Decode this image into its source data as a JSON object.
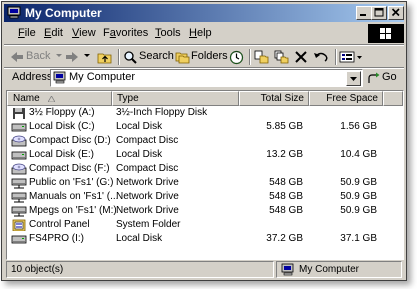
{
  "window": {
    "title": "My Computer"
  },
  "title_buttons": [
    "minimize",
    "maximize",
    "close"
  ],
  "menu": [
    {
      "label": "File",
      "u": "F",
      "rest": "ile"
    },
    {
      "label": "Edit",
      "u": "E",
      "rest": "dit"
    },
    {
      "label": "View",
      "u": "V",
      "rest": "iew"
    },
    {
      "label": "Favorites",
      "u": "a",
      "pre": "F",
      "rest": "vorites"
    },
    {
      "label": "Tools",
      "u": "T",
      "rest": "ools"
    },
    {
      "label": "Help",
      "u": "H",
      "rest": "elp"
    }
  ],
  "toolbar": {
    "back_label": "Back",
    "search_label": "Search",
    "folders_label": "Folders"
  },
  "address": {
    "label": "Address",
    "value": "My Computer",
    "go_label": "Go"
  },
  "columns": {
    "name": "Name",
    "type": "Type",
    "total_size": "Total Size",
    "free_space": "Free Space"
  },
  "rows": [
    {
      "name": "3½ Floppy (A:)",
      "type": "3½-Inch Floppy Disk",
      "total": "",
      "free": "",
      "icon": "floppy-icon"
    },
    {
      "name": "Local Disk (C:)",
      "type": "Local Disk",
      "total": "5.85 GB",
      "free": "1.56 GB",
      "icon": "hard-disk-icon"
    },
    {
      "name": "Compact Disc (D:)",
      "type": "Compact Disc",
      "total": "",
      "free": "",
      "icon": "cd-drive-icon"
    },
    {
      "name": "Local Disk (E:)",
      "type": "Local Disk",
      "total": "13.2 GB",
      "free": "10.4 GB",
      "icon": "hard-disk-icon"
    },
    {
      "name": "Compact Disc (F:)",
      "type": "Compact Disc",
      "total": "",
      "free": "",
      "icon": "cd-drive-icon"
    },
    {
      "name": "Public on 'Fs1' (G:)",
      "type": "Network Drive",
      "total": "548 GB",
      "free": "50.9 GB",
      "icon": "network-drive-icon"
    },
    {
      "name": "Manuals on 'Fs1' (...",
      "type": "Network Drive",
      "total": "548 GB",
      "free": "50.9 GB",
      "icon": "network-drive-icon"
    },
    {
      "name": "Mpegs on 'Fs1' (M:)",
      "type": "Network Drive",
      "total": "548 GB",
      "free": "50.9 GB",
      "icon": "network-drive-icon"
    },
    {
      "name": "Control Panel",
      "type": "System Folder",
      "total": "",
      "free": "",
      "icon": "control-panel-icon"
    },
    {
      "name": "FS4PRO (I:)",
      "type": "Local Disk",
      "total": "37.2 GB",
      "free": "37.1 GB",
      "icon": "hard-disk-icon"
    }
  ],
  "status": {
    "left": "10 object(s)",
    "right": "My Computer"
  }
}
